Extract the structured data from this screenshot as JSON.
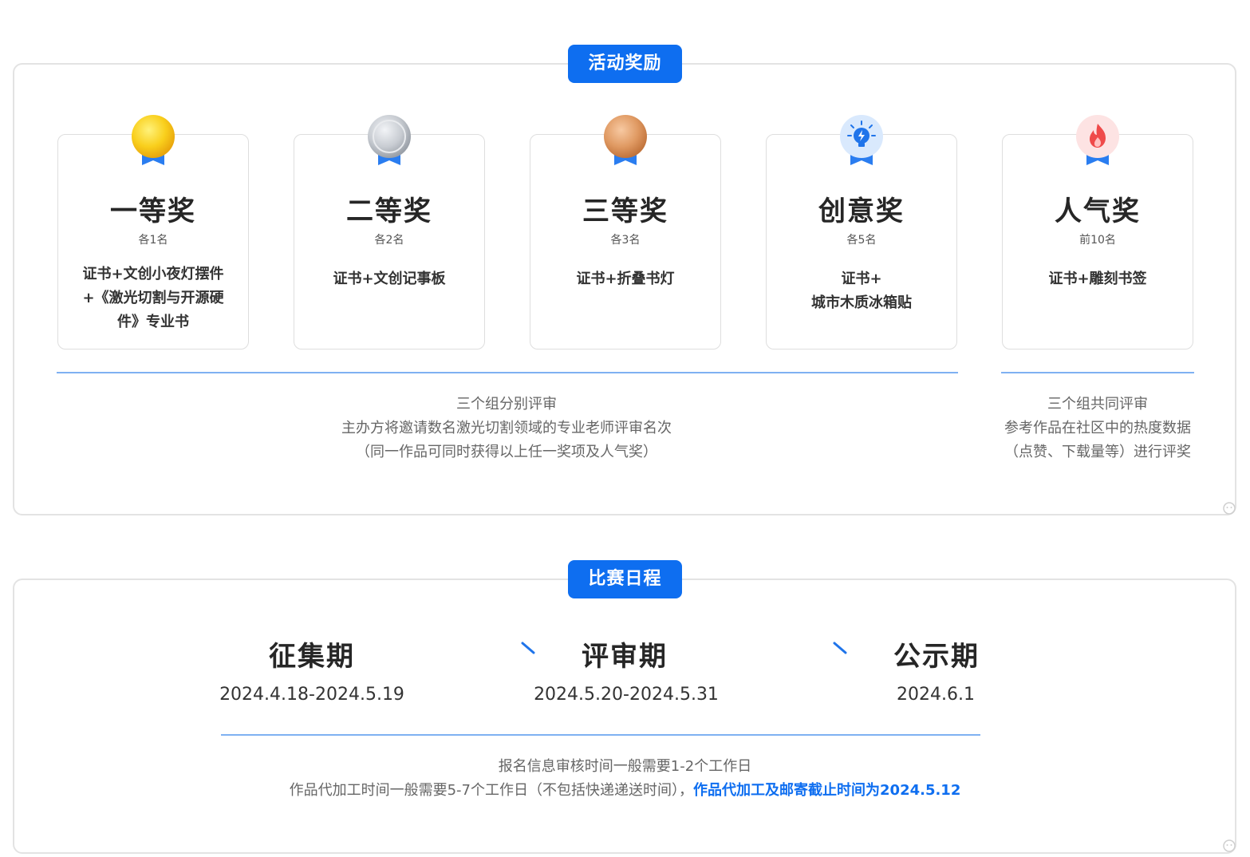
{
  "awards": {
    "tag": "活动奖励",
    "prizes": [
      {
        "title": "一等奖",
        "count": "各1名",
        "reward_lines": [
          "证书+文创小夜灯摆件",
          "+《激光切割与开源硬",
          "件》专业书"
        ],
        "medal": "gold-medal-icon"
      },
      {
        "title": "二等奖",
        "count": "各2名",
        "reward_lines": [
          "证书+文创记事板"
        ],
        "medal": "silver-medal-icon"
      },
      {
        "title": "三等奖",
        "count": "各3名",
        "reward_lines": [
          "证书+折叠书灯"
        ],
        "medal": "bronze-medal-icon"
      },
      {
        "title": "创意奖",
        "count": "各5名",
        "reward_lines": [
          "证书+",
          "城市木质冰箱贴"
        ],
        "medal": "lightbulb-medal-icon"
      },
      {
        "title": "人气奖",
        "count": "前10名",
        "reward_lines": [
          "证书+雕刻书签"
        ],
        "medal": "flame-medal-icon"
      }
    ],
    "left_note": [
      "三个组分别评审",
      "主办方将邀请数名激光切割领域的专业老师评审名次",
      "（同一作品可同时获得以上任一奖项及人气奖）"
    ],
    "right_note": [
      "三个组共同评审",
      "参考作品在社区中的热度数据",
      "（点赞、下载量等）进行评奖"
    ]
  },
  "schedule": {
    "tag": "比赛日程",
    "stages": [
      {
        "title": "征集期",
        "date": "2024.4.18-2024.5.19"
      },
      {
        "title": "评审期",
        "date": "2024.5.20-2024.5.31"
      },
      {
        "title": "公示期",
        "date": "2024.6.1"
      }
    ],
    "note_line1": "报名信息审核时间一般需要1-2个工作日",
    "note_line2": "作品代加工时间一般需要5-7个工作日（不包括快递递送时间），",
    "note_highlight": "作品代加工及邮寄截止时间为2024.5.12"
  },
  "colors": {
    "accent": "#0e6ef0",
    "divider": "#7fb1f2",
    "gold": "#f7c31a",
    "silver": "#b9bec6",
    "bronze": "#d88f55",
    "creative": "#2a7df0",
    "popular": "#ef4a4a"
  }
}
